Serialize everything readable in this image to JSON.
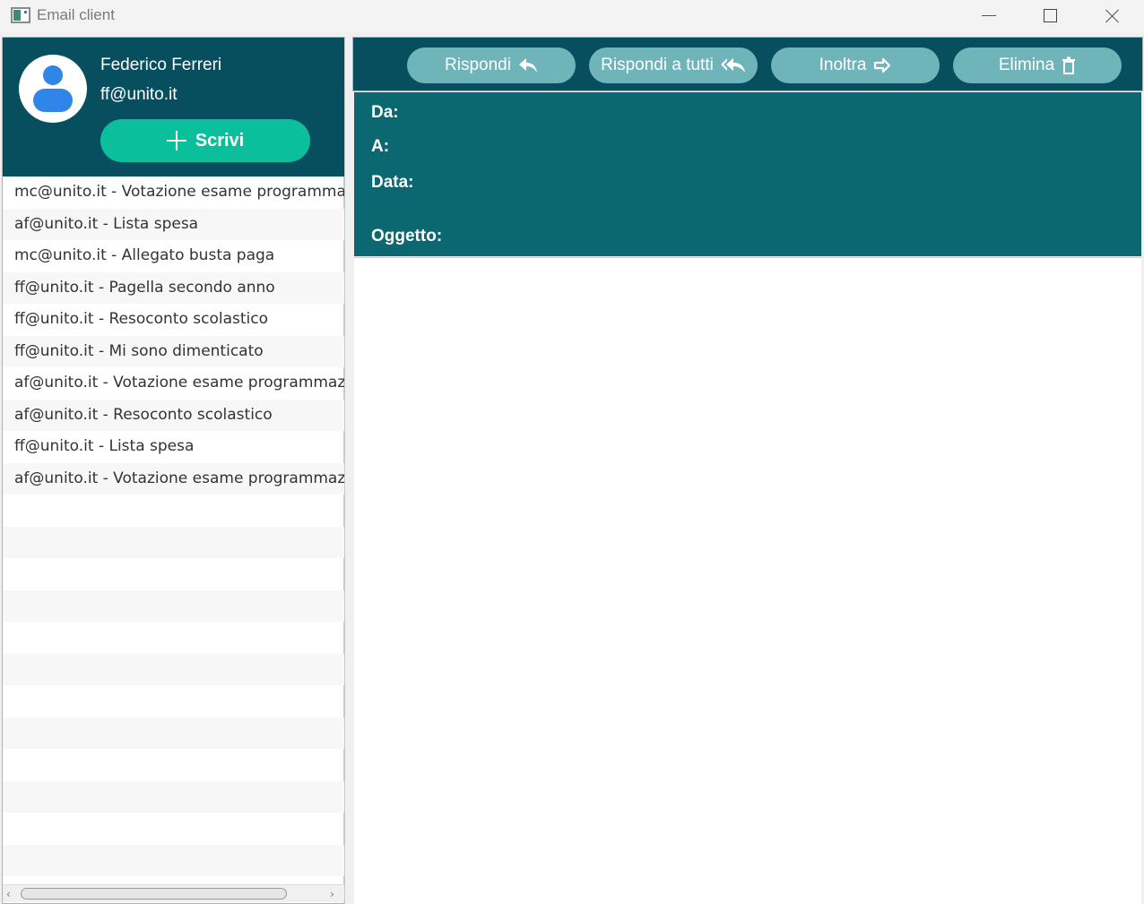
{
  "window": {
    "title": "Email client"
  },
  "user": {
    "name": "Federico Ferreri",
    "email": "ff@unito.it"
  },
  "compose": {
    "label": "Scrivi"
  },
  "emails": [
    "mc@unito.it - Votazione esame programmazione",
    "af@unito.it - Lista spesa",
    "mc@unito.it - Allegato busta paga",
    "ff@unito.it - Pagella secondo anno",
    "ff@unito.it - Resoconto scolastico",
    "ff@unito.it - Mi sono dimenticato",
    "af@unito.it - Votazione esame programmazione",
    "af@unito.it - Resoconto scolastico",
    "ff@unito.it - Lista spesa",
    "af@unito.it - Votazione esame programmazione"
  ],
  "toolbar": {
    "reply": "Rispondi",
    "reply_all": "Rispondi a tutti",
    "forward": "Inoltra",
    "delete": "Elimina"
  },
  "message": {
    "from_label": "Da:",
    "to_label": "A:",
    "date_label": "Data:",
    "subject_label": "Oggetto:"
  },
  "colors": {
    "profile_bg": "#074f5e",
    "header_bg": "#0b6870",
    "compose_btn": "#0bbf9c",
    "toolbar_btn": "#6fb4b9"
  }
}
